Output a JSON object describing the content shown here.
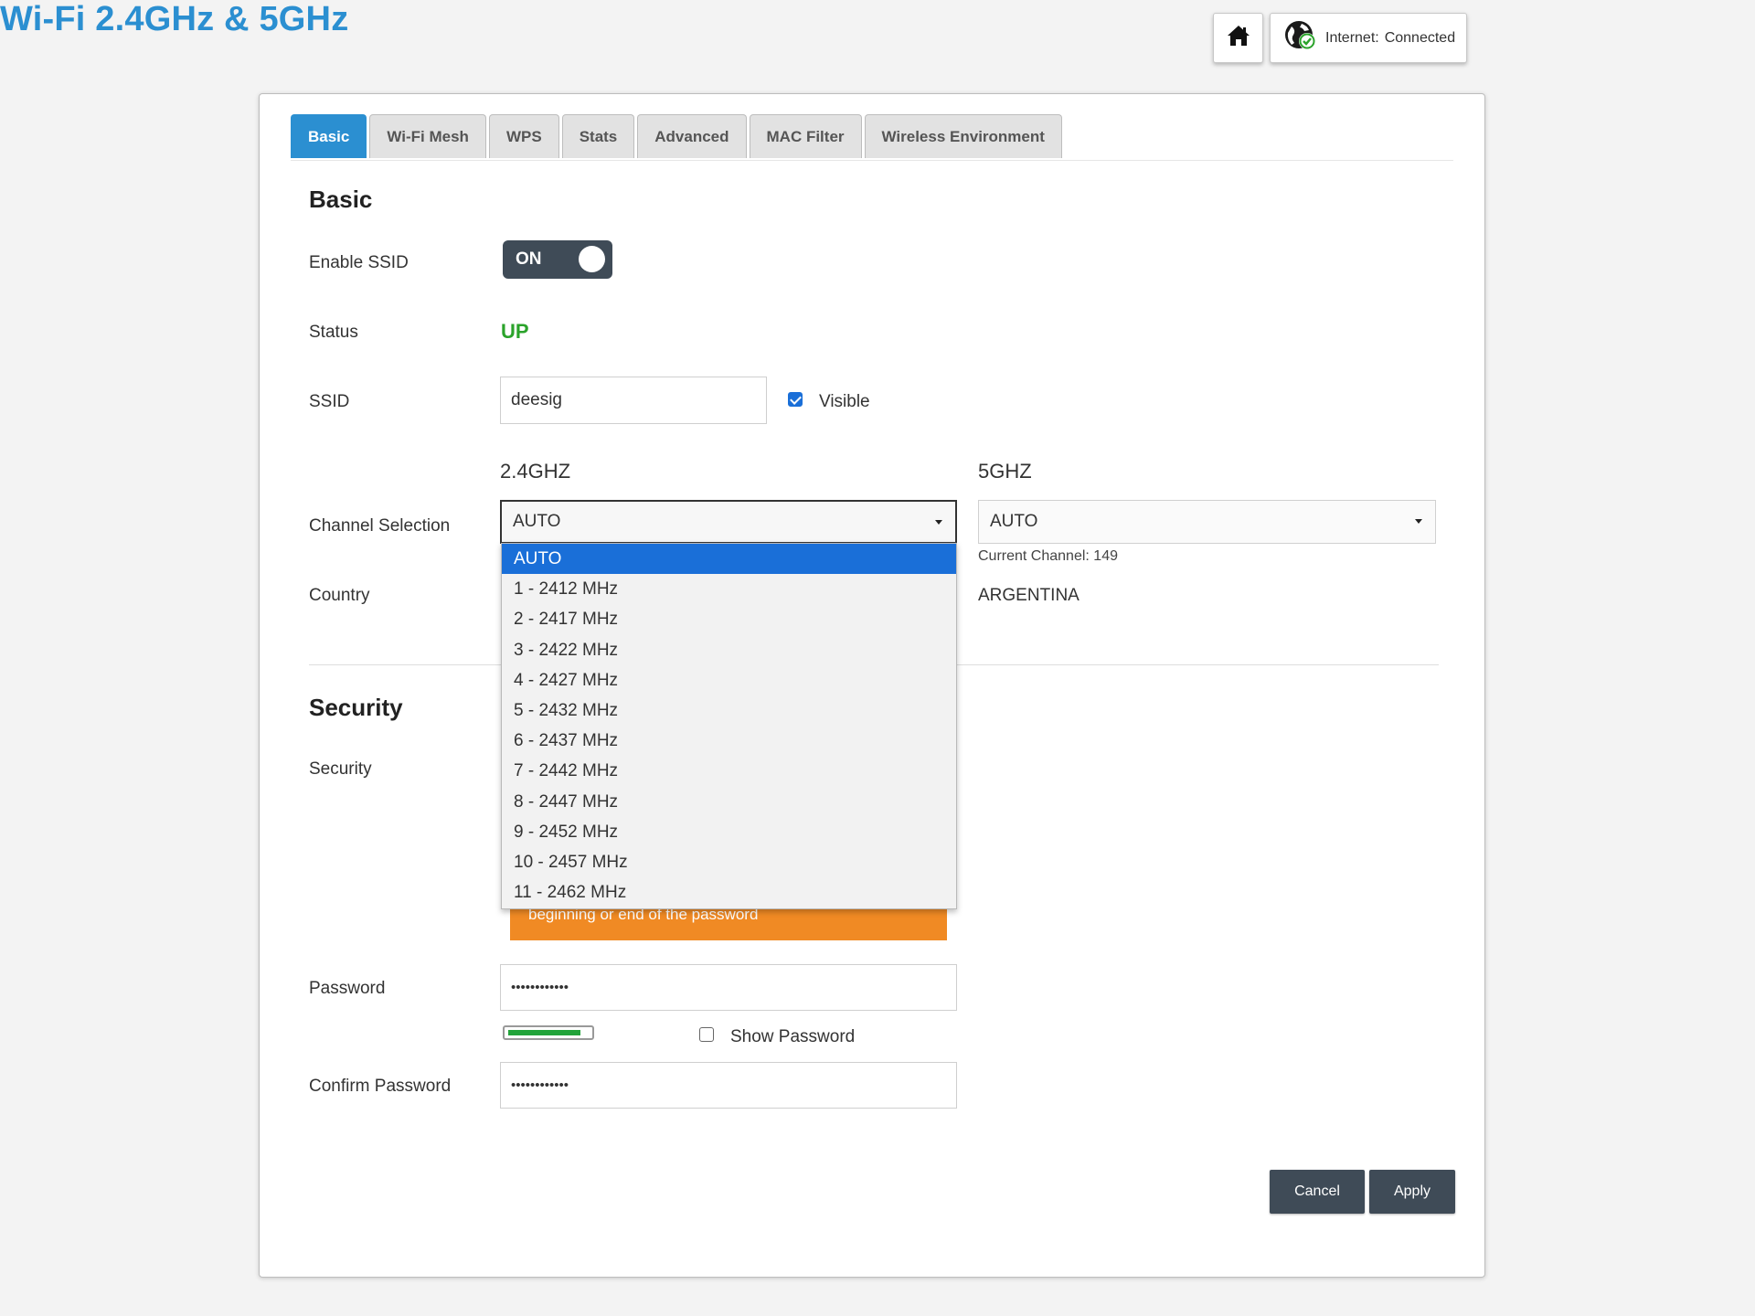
{
  "header": {
    "title": "Wi-Fi 2.4GHz & 5GHz",
    "internet_label": "Internet:",
    "internet_status": "Connected"
  },
  "tabs": [
    {
      "label": "Basic",
      "active": true
    },
    {
      "label": "Wi-Fi Mesh"
    },
    {
      "label": "WPS"
    },
    {
      "label": "Stats"
    },
    {
      "label": "Advanced"
    },
    {
      "label": "MAC Filter"
    },
    {
      "label": "Wireless Environment"
    }
  ],
  "basic": {
    "heading": "Basic",
    "enable_ssid_label": "Enable SSID",
    "enable_ssid_value": "ON",
    "status_label": "Status",
    "status_value": "UP",
    "ssid_label": "SSID",
    "ssid_value": "deesig",
    "visible_label": "Visible",
    "visible_checked": true,
    "band_24": "2.4GHZ",
    "band_5": "5GHZ",
    "channel_label": "Channel Selection",
    "channel_24_value": "AUTO",
    "channel_5_value": "AUTO",
    "current_channel_5": "Current Channel: 149",
    "country_label": "Country",
    "country_value": "ARGENTINA"
  },
  "channel_options_24": [
    "AUTO",
    "1 - 2412 MHz",
    "2 - 2417 MHz",
    "3 - 2422 MHz",
    "4 - 2427 MHz",
    "5 - 2432 MHz",
    "6 - 2437 MHz",
    "7 - 2442 MHz",
    "8 - 2447 MHz",
    "9 - 2452 MHz",
    "10 - 2457 MHz",
    "11 - 2462 MHz"
  ],
  "security": {
    "heading": "Security",
    "security_label": "Security",
    "warning_text": "beginning or end of the password",
    "password_label": "Password",
    "password_value": "••••••••••••",
    "show_password_label": "Show Password",
    "show_password_checked": false,
    "confirm_label": "Confirm Password",
    "confirm_value": "••••••••••••",
    "strength_level": 0.9,
    "strength_color": "#22a33a"
  },
  "actions": {
    "cancel": "Cancel",
    "apply": "Apply"
  },
  "colors": {
    "brand": "#2b8fd1",
    "status_up": "#2ba32b",
    "dark_button": "#3f4b57",
    "warning": "#f08a24",
    "selected_option": "#1a6fd8"
  }
}
